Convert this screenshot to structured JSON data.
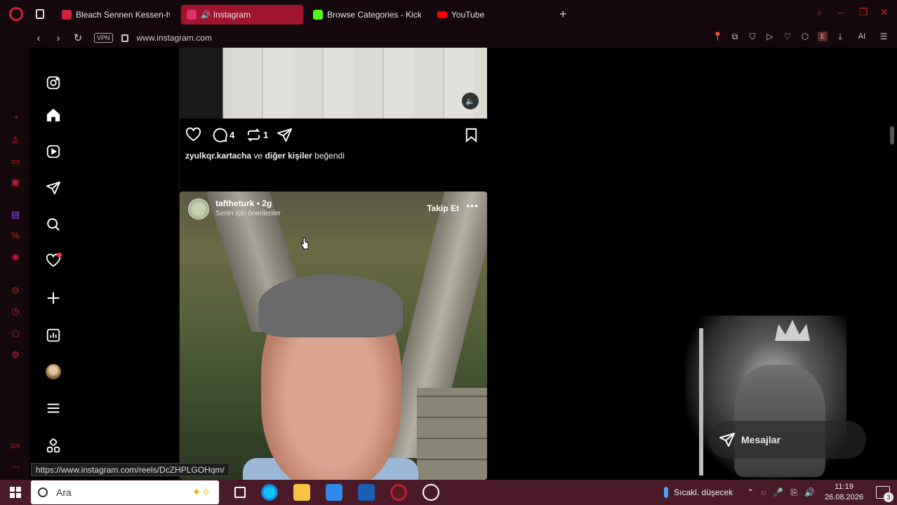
{
  "browser": {
    "tabs": [
      {
        "label": "Bleach Sennen Kessen-hen",
        "fav_color": "#d0203a",
        "active": false
      },
      {
        "label": "Instagram",
        "fav_color": "#e1306c",
        "active": true
      },
      {
        "label": "Browse Categories - Kick",
        "fav_color": "#53fc18",
        "active": false
      },
      {
        "label": "YouTube",
        "fav_color": "#ff0000",
        "active": false
      }
    ],
    "vpn_label": "VPN",
    "url": "www.instagram.com",
    "ai_label": "AI",
    "ext_e": "E"
  },
  "feed": {
    "post1": {
      "comment_count": "4",
      "repost_count": "1",
      "liked_by_user": "zyulkqr.kartacha",
      "liked_mid": "ve",
      "liked_others": "diğer kişiler",
      "liked_suffix": "beğendi"
    },
    "post2": {
      "username": "taftheturk",
      "time": "• 2g",
      "subtitle": "Senin için önerilenler",
      "follow_label": "Takip Et",
      "more": "•••"
    }
  },
  "status_url": "https://www.instagram.com/reels/DcZHPLGOHqm/",
  "messages_label": "Mesajlar",
  "taskbar": {
    "search_placeholder": "Ara",
    "weather": "Sıcakl. düşecek",
    "time": "11:19",
    "date": "26.08.2026",
    "notif_count": "3"
  },
  "colors": {
    "accent": "#d0203a",
    "taskbar": "#4a1a28"
  }
}
